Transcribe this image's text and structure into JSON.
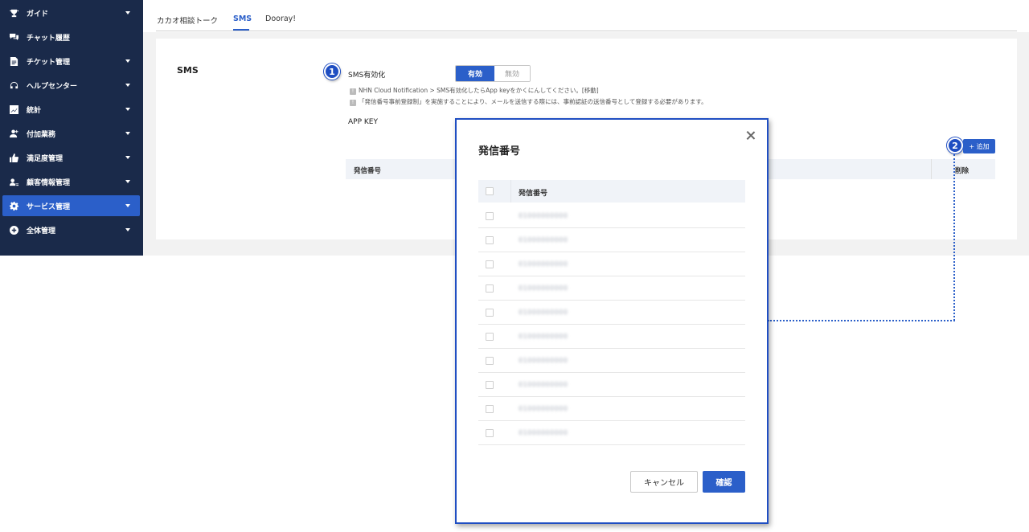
{
  "sidebar": {
    "items": [
      {
        "label": "ガイド",
        "icon": "trophy-icon",
        "has_caret": true,
        "active": false
      },
      {
        "label": "チャット履歴",
        "icon": "chat-icon",
        "has_caret": false,
        "active": false
      },
      {
        "label": "チケット管理",
        "icon": "document-icon",
        "has_caret": true,
        "active": false
      },
      {
        "label": "ヘルプセンター",
        "icon": "headset-icon",
        "has_caret": true,
        "active": false
      },
      {
        "label": "統計",
        "icon": "chart-icon",
        "has_caret": true,
        "active": false
      },
      {
        "label": "付加業務",
        "icon": "user-plus-icon",
        "has_caret": true,
        "active": false
      },
      {
        "label": "満足度管理",
        "icon": "thumbs-up-icon",
        "has_caret": true,
        "active": false
      },
      {
        "label": "顧客情報管理",
        "icon": "user-card-icon",
        "has_caret": true,
        "active": false
      },
      {
        "label": "サービス管理",
        "icon": "gear-icon",
        "has_caret": true,
        "active": true
      },
      {
        "label": "全体管理",
        "icon": "plus-circle-icon",
        "has_caret": true,
        "active": false
      }
    ]
  },
  "tabs": [
    {
      "label": "カカオ相談トーク",
      "active": false
    },
    {
      "label": "SMS",
      "active": true
    },
    {
      "label": "Dooray!",
      "active": false
    }
  ],
  "section": {
    "title": "SMS",
    "enable_label": "SMS有効化",
    "toggle_on": "有効",
    "toggle_off": "無効",
    "notes": [
      "NHN Cloud Notification > SMS有効化したらApp keyをかくにんしてください。[移動]",
      "「発信番号事前登録制」を実施することにより、メールを送信する際には、事前認証の送信番号として登録する必要があります。"
    ],
    "note_mark": "!",
    "appkey_label": "APP KEY",
    "add_button": "+ 追加",
    "table_headers": [
      "発信番号",
      "削除"
    ]
  },
  "badges": [
    "1",
    "2"
  ],
  "modal": {
    "title": "発信番号",
    "column_header": "発信番号",
    "rows": [
      "01000000000",
      "01000000000",
      "01000000000",
      "01000000000",
      "01000000000",
      "01000000000",
      "01000000000",
      "01000000000",
      "01000000000",
      "01000000000"
    ],
    "cancel_label": "キャンセル",
    "confirm_label": "確認"
  },
  "colors": {
    "sidebar_bg": "#1a2a4a",
    "accent": "#2b5fc9",
    "annotation": "#1f4ec2"
  }
}
